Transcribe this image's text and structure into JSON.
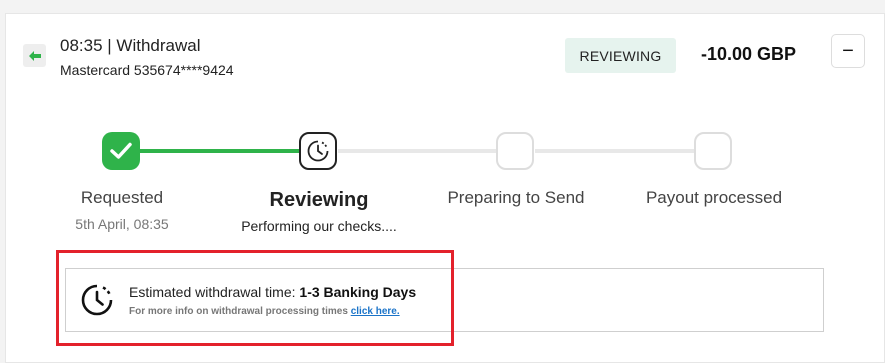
{
  "colors": {
    "accent_green": "#2fb34a",
    "status_bg": "#e6f3ee",
    "highlight_red": "#e3212b",
    "link_blue": "#1a73c8"
  },
  "header": {
    "back_icon": "arrow-left-icon",
    "title": "08:35 | Withdrawal",
    "card": "Mastercard 535674****9424",
    "status": "REVIEWING",
    "amount": "-10.00 GBP",
    "collapse_label": "−"
  },
  "progress": {
    "steps": [
      {
        "label": "Requested",
        "sub": "5th April, 08:35",
        "state": "done",
        "icon": "check-icon"
      },
      {
        "label": "Reviewing",
        "sub": "Performing our checks....",
        "state": "active",
        "icon": "clock-icon"
      },
      {
        "label": "Preparing to Send",
        "sub": "",
        "state": "pending",
        "icon": ""
      },
      {
        "label": "Payout processed",
        "sub": "",
        "state": "pending",
        "icon": ""
      }
    ]
  },
  "info": {
    "icon": "clock-icon",
    "prefix": "Estimated withdrawal time: ",
    "time": "1-3 Banking Days",
    "small_prefix": "For more info on withdrawal processing times ",
    "link": "click here."
  }
}
